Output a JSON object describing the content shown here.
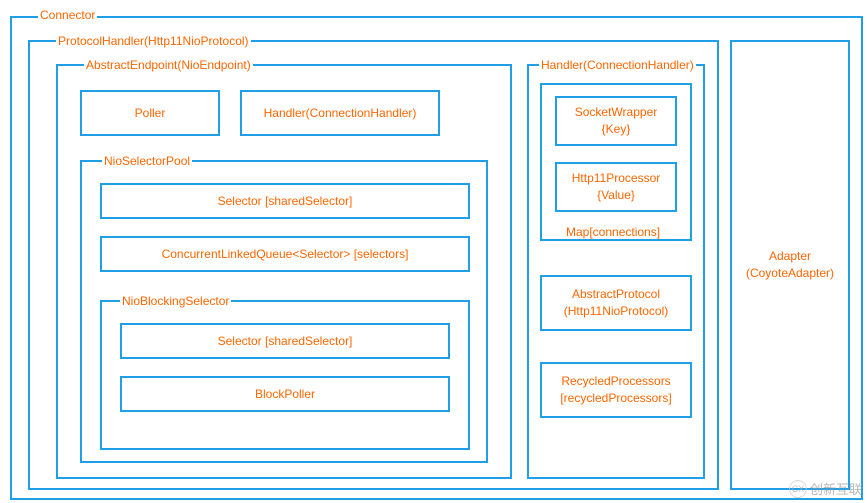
{
  "connector": {
    "label": "Connector"
  },
  "protocolHandler": {
    "label": "ProtocolHandler(Http11NioProtocol)"
  },
  "abstractEndpoint": {
    "label": "AbstractEndpoint(NioEndpoint)",
    "poller": "Poller",
    "handler": "Handler(ConnectionHandler)"
  },
  "nioSelectorPool": {
    "label": "NioSelectorPool",
    "selector": "Selector [sharedSelector]",
    "queue": "ConcurrentLinkedQueue<Selector> [selectors]"
  },
  "nioBlockingSelector": {
    "label": "NioBlockingSelector",
    "selector": "Selector [sharedSelector]",
    "blockPoller": "BlockPoller"
  },
  "connectionHandler": {
    "label": "Handler(ConnectionHandler)",
    "socketWrapper": "SocketWrapper\n{Key}",
    "http11Processor": "Http11Processor\n{Value}",
    "mapLabel": "Map[connections]",
    "abstractProtocol": "AbstractProtocol\n(Http11NioProtocol)",
    "recycledProcessors": "RecycledProcessors\n[recycledProcessors]"
  },
  "adapter": {
    "label": "Adapter\n(CoyoteAdapter)"
  },
  "watermark": "创新互联"
}
